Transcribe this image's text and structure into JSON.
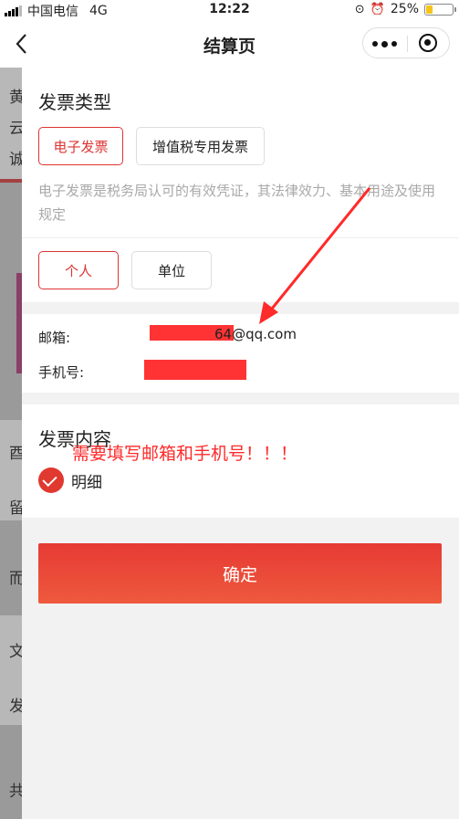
{
  "status_bar": {
    "carrier": "中国电信",
    "network": "4G",
    "time": "12:22",
    "battery": "25%",
    "battery_level": 0.25
  },
  "nav": {
    "title": "结算页",
    "back_icon": "chevron-left-icon",
    "more_icon": "more-dots-icon",
    "close_icon": "target-circle-icon"
  },
  "background_page": {
    "visible_glyphs": [
      "黄",
      "云",
      "诚",
      "酉",
      "留",
      "而",
      "文",
      "发",
      "共"
    ]
  },
  "invoice_type": {
    "title": "发票类型",
    "options": [
      {
        "label": "电子发票",
        "selected": true
      },
      {
        "label": "增值税专用发票",
        "selected": false
      }
    ],
    "description": "电子发票是税务局认可的有效凭证，其法律效力、基本用途及使用规定"
  },
  "invoice_header": {
    "options": [
      {
        "label": "个人",
        "selected": true
      },
      {
        "label": "单位",
        "selected": false
      }
    ]
  },
  "contact": {
    "email_label": "邮箱:",
    "email_value_visible": "64@qq.com",
    "phone_label": "手机号:"
  },
  "invoice_content": {
    "title": "发票内容",
    "option_label": "明细",
    "option_checked": true
  },
  "annotation": {
    "text": "需要填写邮箱和手机号！！！",
    "color": "#ff2a2a"
  },
  "confirm_button": {
    "label": "确定"
  },
  "colors": {
    "accent": "#d33333",
    "button": "#e63a34",
    "redaction": "#ff3333"
  }
}
